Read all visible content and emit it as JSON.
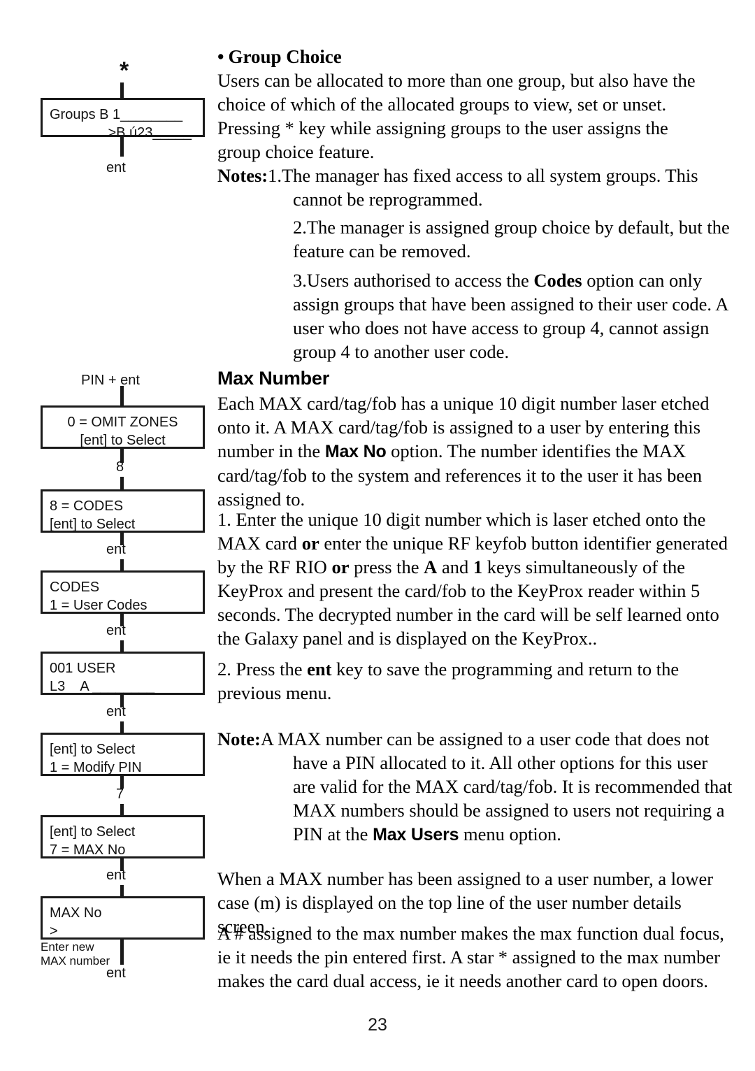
{
  "page": {
    "number": "23"
  },
  "flowchart_top": {
    "star": "*",
    "box": {
      "line1": "Groups B 1________",
      "line2": ">B ú23_____"
    },
    "exit_label": "ent"
  },
  "flowchart_main": {
    "entry_label": "PIN + ent",
    "steps": [
      {
        "name": "omit-zones",
        "line1": "0 = OMIT ZONES",
        "line2": "[ent] to Select",
        "next_label": "8"
      },
      {
        "name": "codes-menu",
        "line1": "8 = CODES",
        "line2": "[ent] to Select",
        "next_label": "ent"
      },
      {
        "name": "user-codes",
        "line1": "CODES",
        "line2": "1 = User Codes",
        "next_label": "ent"
      },
      {
        "name": "user-001",
        "line1": "001 USER",
        "line2": "L3    A ________",
        "next_label": "ent"
      },
      {
        "name": "modify-pin",
        "line1": "[ent] to Select",
        "line2": "1 = Modify PIN",
        "next_label": "7"
      },
      {
        "name": "max-no-select",
        "line1": "[ent] to Select",
        "line2": "7 = MAX No",
        "next_label": "ent"
      },
      {
        "name": "max-no-entry",
        "line1": "MAX No",
        "line2": ">",
        "next_label": "ent"
      }
    ],
    "side_note": {
      "line1": "Enter new",
      "line2": "MAX number"
    }
  },
  "content": {
    "group_choice": {
      "bullet": "•",
      "heading": "Group Choice",
      "body": "Users can be allocated to more than one group, but also have the choice of which of the allocated groups to view, set or unset. Pressing * key while assigning groups to the user assigns the group choice feature."
    },
    "notes": {
      "label": "Notes:",
      "items": [
        {
          "number": "1.",
          "text": "The manager has fixed access to all system groups. This cannot be reprogrammed."
        },
        {
          "number": "2.",
          "text": "The manager is assigned group choice by default, but the feature can be removed."
        },
        {
          "number": "3.",
          "text_before": "Users authorised to access the ",
          "bold": "Codes",
          "text_after": " option can only assign groups that have been assigned to their user code. A user who does not have access to group 4, cannot assign group 4 to another user code."
        }
      ]
    },
    "max_number": {
      "heading": "Max Number",
      "intro_a": "Each MAX card/tag/fob has a unique 10 digit number laser etched onto it. A MAX card/tag/fob is assigned to a user by entering this number in the ",
      "intro_bold": "Max No",
      "intro_b": " option. The number identifies the MAX card/tag/fob to the system and references it to the user it has been assigned to.",
      "step1": {
        "number": "1.",
        "a": " Enter the unique 10 digit number which is laser etched onto the MAX card ",
        "b1": "or",
        "c": " enter the unique RF keyfob button identifier generated by the RF RIO ",
        "b2": "or",
        "d": " press the ",
        "b3": "A",
        "e": " and ",
        "b4": "1",
        "f": " keys simultaneously of the KeyProx and present the card/fob to the KeyProx reader within 5 seconds. The decrypted number in the card will be self learned onto the Galaxy panel and is displayed on the KeyProx.."
      },
      "step2": {
        "number": "2.",
        "a": " Press the ",
        "b": "ent",
        "c": " key to save the programming and return to the previous menu."
      },
      "note": {
        "label": "Note:",
        "a": "A MAX number can be assigned to a user code that does not have a PIN allocated to it. All other options for this user are valid for the MAX card/tag/fob. It is recommended that MAX numbers should be assigned to users not requiring a PIN at the ",
        "bold": "Max Users",
        "b": " menu option."
      },
      "para_m": "When a MAX number has been assigned to a user number, a lower case (m) is displayed on the top line of the user number details screen.",
      "para_hash": "A # assigned to the max number makes the max function dual focus, ie it needs the pin entered first. A star * assigned to the max number makes the card dual access, ie it needs another card to open doors."
    }
  }
}
